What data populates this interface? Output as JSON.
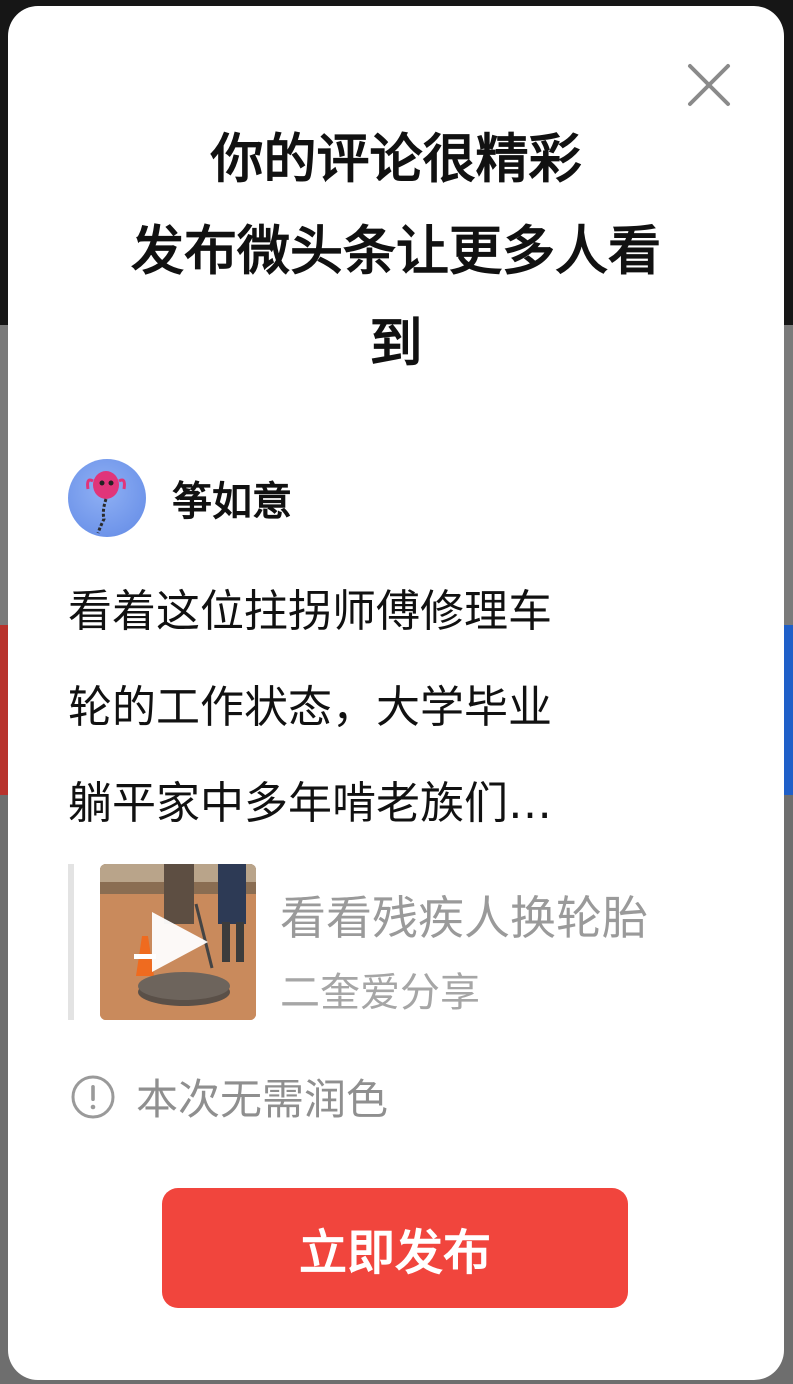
{
  "dialog": {
    "headline_lines": [
      "你的评论很精彩",
      "发布微头条让更多人看",
      "到"
    ],
    "close_icon": "close-icon"
  },
  "author": {
    "name": "筝如意",
    "avatar_icon": "kite-avatar"
  },
  "comment": {
    "lines": [
      "看着这位拄拐师傅修理车",
      "轮的工作状态，大学毕业",
      "躺平家中多年啃老族们…"
    ]
  },
  "quoted_post": {
    "title": "看看残疾人换轮胎",
    "author": "二奎爱分享",
    "play_icon": "play-icon"
  },
  "notice": {
    "icon": "info-icon",
    "text": "本次无需润色"
  },
  "publish_button": {
    "label": "立即发布"
  },
  "colors": {
    "accent": "#f1453d",
    "muted_text": "#9a9a9a",
    "primary_text": "#111111"
  }
}
